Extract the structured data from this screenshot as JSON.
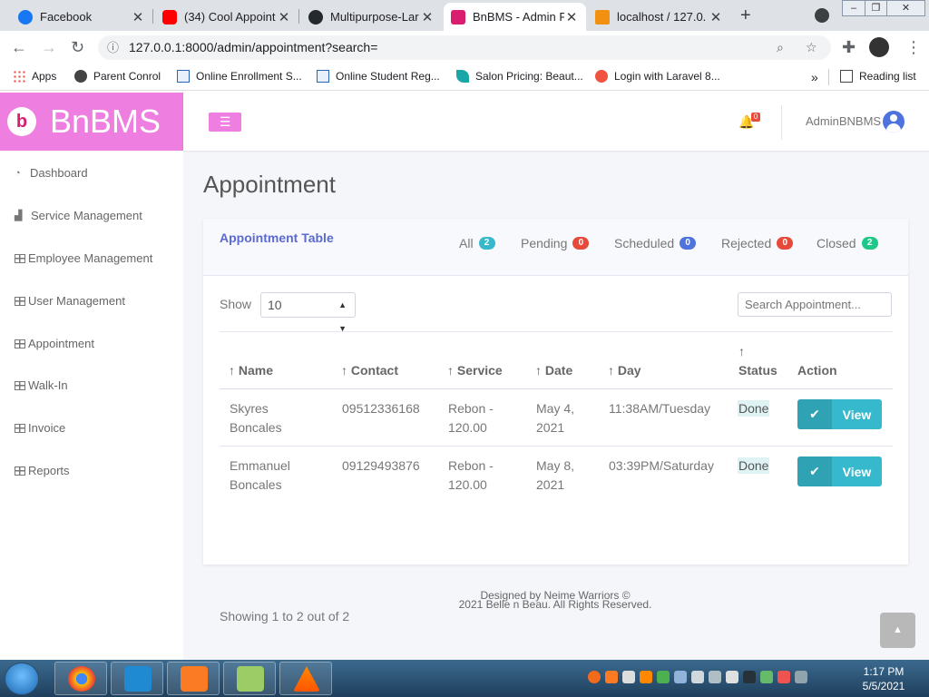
{
  "browser": {
    "tabs": [
      {
        "title": "Facebook",
        "icon": "facebook-icon",
        "color": "#1877f2"
      },
      {
        "title": "(34) Cool Appoint",
        "icon": "youtube-icon",
        "color": "#ff0000"
      },
      {
        "title": "Multipurpose-Lar",
        "icon": "github-icon",
        "color": "#24292e"
      },
      {
        "title": "BnBMS - Admin P",
        "icon": "bnbms-icon",
        "color": "#d91d6f"
      },
      {
        "title": "localhost / 127.0.",
        "icon": "phpmyadmin-icon",
        "color": "#f29111"
      }
    ],
    "close_glyph": "✕",
    "new_tab_glyph": "+",
    "url": "127.0.0.1:8000/admin/appointment?search=",
    "bookmarks": [
      {
        "label": "Apps",
        "icon": "apps-grid-icon"
      },
      {
        "label": "Parent Conrol",
        "icon": "globe-icon"
      },
      {
        "label": "Online Enrollment S...",
        "icon": "isc-icon"
      },
      {
        "label": "Online Student Reg...",
        "icon": "isc-icon"
      },
      {
        "label": "Salon Pricing: Beaut...",
        "icon": "salon-icon"
      },
      {
        "label": "Login with Laravel 8...",
        "icon": "laravel-icon"
      }
    ],
    "more_glyph": "»",
    "reading_list": "Reading list"
  },
  "app": {
    "brand": "BnBMS",
    "brand_logo_glyph": "b",
    "menu_glyph": "☰",
    "notification_count": "0",
    "admin_name": "AdminBNBMS",
    "sidebar": [
      {
        "label": "Dashboard",
        "icon": "dashboard-icon"
      },
      {
        "label": "Service Management",
        "icon": "chart-icon"
      },
      {
        "label": "Employee Management",
        "icon": "table-icon"
      },
      {
        "label": "User Management",
        "icon": "table-icon"
      },
      {
        "label": "Appointment",
        "icon": "table-icon"
      },
      {
        "label": "Walk-In",
        "icon": "table-icon"
      },
      {
        "label": "Invoice",
        "icon": "table-icon"
      },
      {
        "label": "Reports",
        "icon": "table-icon"
      }
    ],
    "page_title": "Appointment",
    "card_title": "Appointment Table",
    "filters": [
      {
        "label": "All",
        "count": "2",
        "color": "#36b9cc"
      },
      {
        "label": "Pending",
        "count": "0",
        "color": "#e74a3b"
      },
      {
        "label": "Scheduled",
        "count": "0",
        "color": "#4e73df"
      },
      {
        "label": "Rejected",
        "count": "0",
        "color": "#e74a3b"
      },
      {
        "label": "Closed",
        "count": "2",
        "color": "#1cc88a"
      }
    ],
    "show_label": "Show",
    "entries_value": "10",
    "search_placeholder": "Search Appointment...",
    "columns": [
      "↑ Name",
      "↑ Contact",
      "↑ Service",
      "↑ Date",
      "↑ Day",
      "↑",
      "Status",
      "Action"
    ],
    "rows": [
      {
        "name": [
          "Skyres",
          "Boncales"
        ],
        "contact": "09512336168",
        "service": [
          "Rebon -",
          "120.00"
        ],
        "date": [
          "May 4,",
          "2021"
        ],
        "day": "11:38AM/Tuesday",
        "status": "Done",
        "action": "View"
      },
      {
        "name": [
          "Emmanuel",
          "Boncales"
        ],
        "contact": "09129493876",
        "service": [
          "Rebon -",
          "120.00"
        ],
        "date": [
          "May 8,",
          "2021"
        ],
        "day": "03:39PM/Saturday",
        "status": "Done",
        "action": "View"
      }
    ],
    "showing": "Showing 1 to 2 out of 2",
    "footer": [
      "Designed by Neime Warriors ©",
      "2021 Belle n Beau. All Rights Reserved."
    ],
    "scroll_top_glyph": "▲"
  },
  "taskbar": {
    "time": "1:17 PM",
    "date": "5/5/2021"
  }
}
